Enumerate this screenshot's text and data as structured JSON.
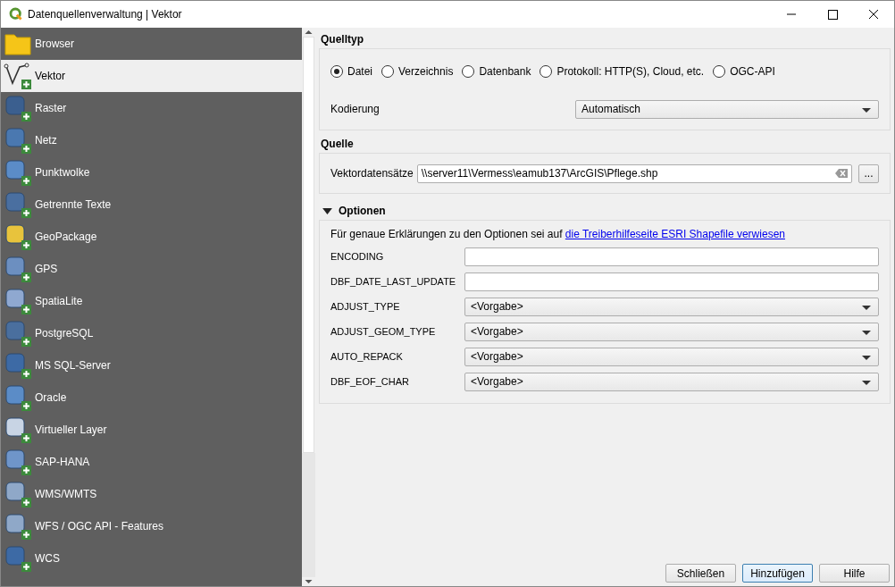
{
  "window": {
    "title": "Datenquellenverwaltung | Vektor"
  },
  "sidebar": {
    "items": [
      {
        "label": "Browser",
        "selected": false
      },
      {
        "label": "Vektor",
        "selected": true
      },
      {
        "label": "Raster",
        "selected": false
      },
      {
        "label": "Netz",
        "selected": false
      },
      {
        "label": "Punktwolke",
        "selected": false
      },
      {
        "label": "Getrennte Texte",
        "selected": false
      },
      {
        "label": "GeoPackage",
        "selected": false
      },
      {
        "label": "GPS",
        "selected": false
      },
      {
        "label": "SpatiaLite",
        "selected": false
      },
      {
        "label": "PostgreSQL",
        "selected": false
      },
      {
        "label": "MS SQL-Server",
        "selected": false
      },
      {
        "label": "Oracle",
        "selected": false
      },
      {
        "label": "Virtueller Layer",
        "selected": false
      },
      {
        "label": "SAP-HANA",
        "selected": false
      },
      {
        "label": "WMS/WMTS",
        "selected": false
      },
      {
        "label": "WFS / OGC API - Features",
        "selected": false
      },
      {
        "label": "WCS",
        "selected": false
      }
    ]
  },
  "source_type": {
    "title": "Quelltyp",
    "options": [
      {
        "label": "Datei",
        "selected": true
      },
      {
        "label": "Verzeichnis",
        "selected": false
      },
      {
        "label": "Datenbank",
        "selected": false
      },
      {
        "label": "Protokoll: HTTP(S), Cloud, etc.",
        "selected": false
      },
      {
        "label": "OGC-API",
        "selected": false
      }
    ],
    "encoding_label": "Kodierung",
    "encoding_value": "Automatisch"
  },
  "source": {
    "title": "Quelle",
    "label": "Vektordatensätze",
    "value": "\\\\server11\\Vermess\\eamub137\\ArcGIS\\Pflege.shp",
    "browse": "..."
  },
  "options": {
    "title": "Optionen",
    "expanded": true,
    "hint": "Für genaue Erklärungen zu den Optionen sei auf ",
    "link": "die Treiberhilfeseite ESRI Shapefile verwiesen",
    "rows": [
      {
        "kind": "text",
        "label": "ENCODING"
      },
      {
        "kind": "text",
        "label": "DBF_DATE_LAST_UPDATE"
      },
      {
        "kind": "combo",
        "label": "ADJUST_TYPE",
        "value": "<Vorgabe>"
      },
      {
        "kind": "combo",
        "label": "ADJUST_GEOM_TYPE",
        "value": "<Vorgabe>"
      },
      {
        "kind": "combo",
        "label": "AUTO_REPACK",
        "value": "<Vorgabe>"
      },
      {
        "kind": "combo",
        "label": "DBF_EOF_CHAR",
        "value": "<Vorgabe>"
      }
    ]
  },
  "buttons": [
    {
      "label": "Schließen",
      "default": false
    },
    {
      "label": "Hinzufügen",
      "default": true
    },
    {
      "label": "Hilfe",
      "default": false
    }
  ]
}
